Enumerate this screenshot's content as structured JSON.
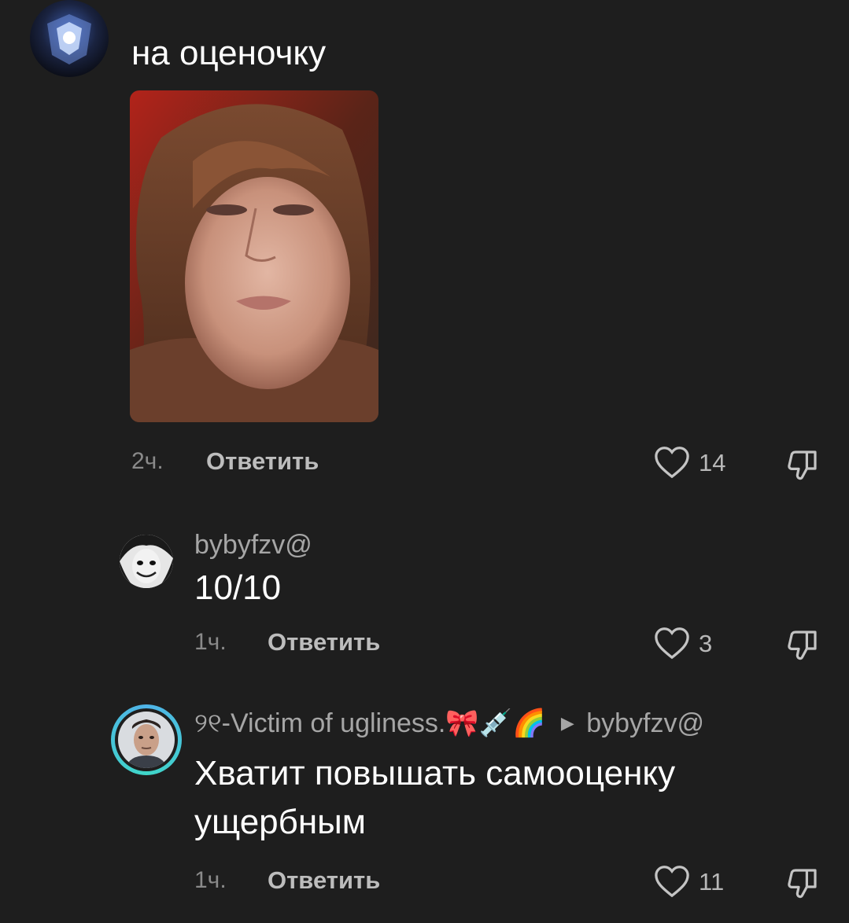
{
  "comments": [
    {
      "text": "на оценочку",
      "time": "2ч.",
      "reply_label": "Ответить",
      "likes": "14"
    },
    {
      "username": "bybyfzv@",
      "text": "10/10",
      "time": "1ч.",
      "reply_label": "Ответить",
      "likes": "3"
    },
    {
      "username": "୨୧-Victim of ugliness.🎀💉🌈",
      "reply_to": "bybyfzv@",
      "text_line1": "Хватит повышать самооценку",
      "text_line2": "ущербным",
      "time": "1ч.",
      "reply_label": "Ответить",
      "likes": "11"
    }
  ],
  "icons": {
    "like": "heart-outline-icon",
    "dislike": "thumbs-down-outline-icon",
    "reply_arrow": "caret-right-icon"
  },
  "colors": {
    "background": "#1e1e1e",
    "secondary_text": "#a6a6a6",
    "story_ring": "#4fb3e8"
  }
}
